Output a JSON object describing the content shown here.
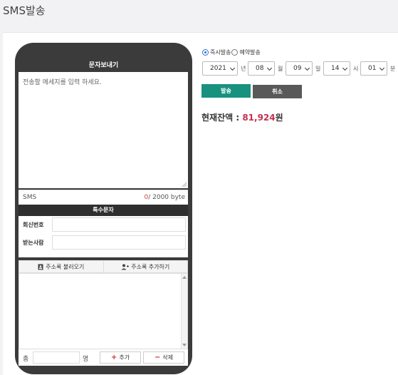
{
  "page": {
    "title": "SMS발송"
  },
  "phone": {
    "title": "문자보내기",
    "message_placeholder": "전송할 메세지를 입력 하세요.",
    "mode": "SMS",
    "byte_count": "0",
    "byte_limit": "/ 2000 byte",
    "special_chars_label": "특수문자",
    "reply_number_label": "회신번호",
    "recipient_label": "받는사람",
    "load_addressbook_label": "주소록 불러오기",
    "add_addressbook_label": "주소록 추가하기",
    "total_label": "총",
    "count_unit": "명",
    "add_label": "추가",
    "delete_label": "삭제"
  },
  "schedule": {
    "immediate_label": "즉시발송",
    "reserved_label": "예약발송",
    "selected": "immediate",
    "year": "2021",
    "year_unit": "년",
    "month": "08",
    "month_unit": "월",
    "day": "09",
    "day_unit": "일",
    "hour": "14",
    "hour_unit": "시",
    "minute": "01",
    "minute_unit": "분"
  },
  "actions": {
    "send_label": "발송",
    "cancel_label": "취소"
  },
  "balance": {
    "label": "현재잔액 : ",
    "amount": "81,924",
    "unit": "원"
  },
  "colors": {
    "send": "#18917f",
    "cancel": "#595959",
    "amount": "#c4304f",
    "phone": "#3b3b3b"
  }
}
